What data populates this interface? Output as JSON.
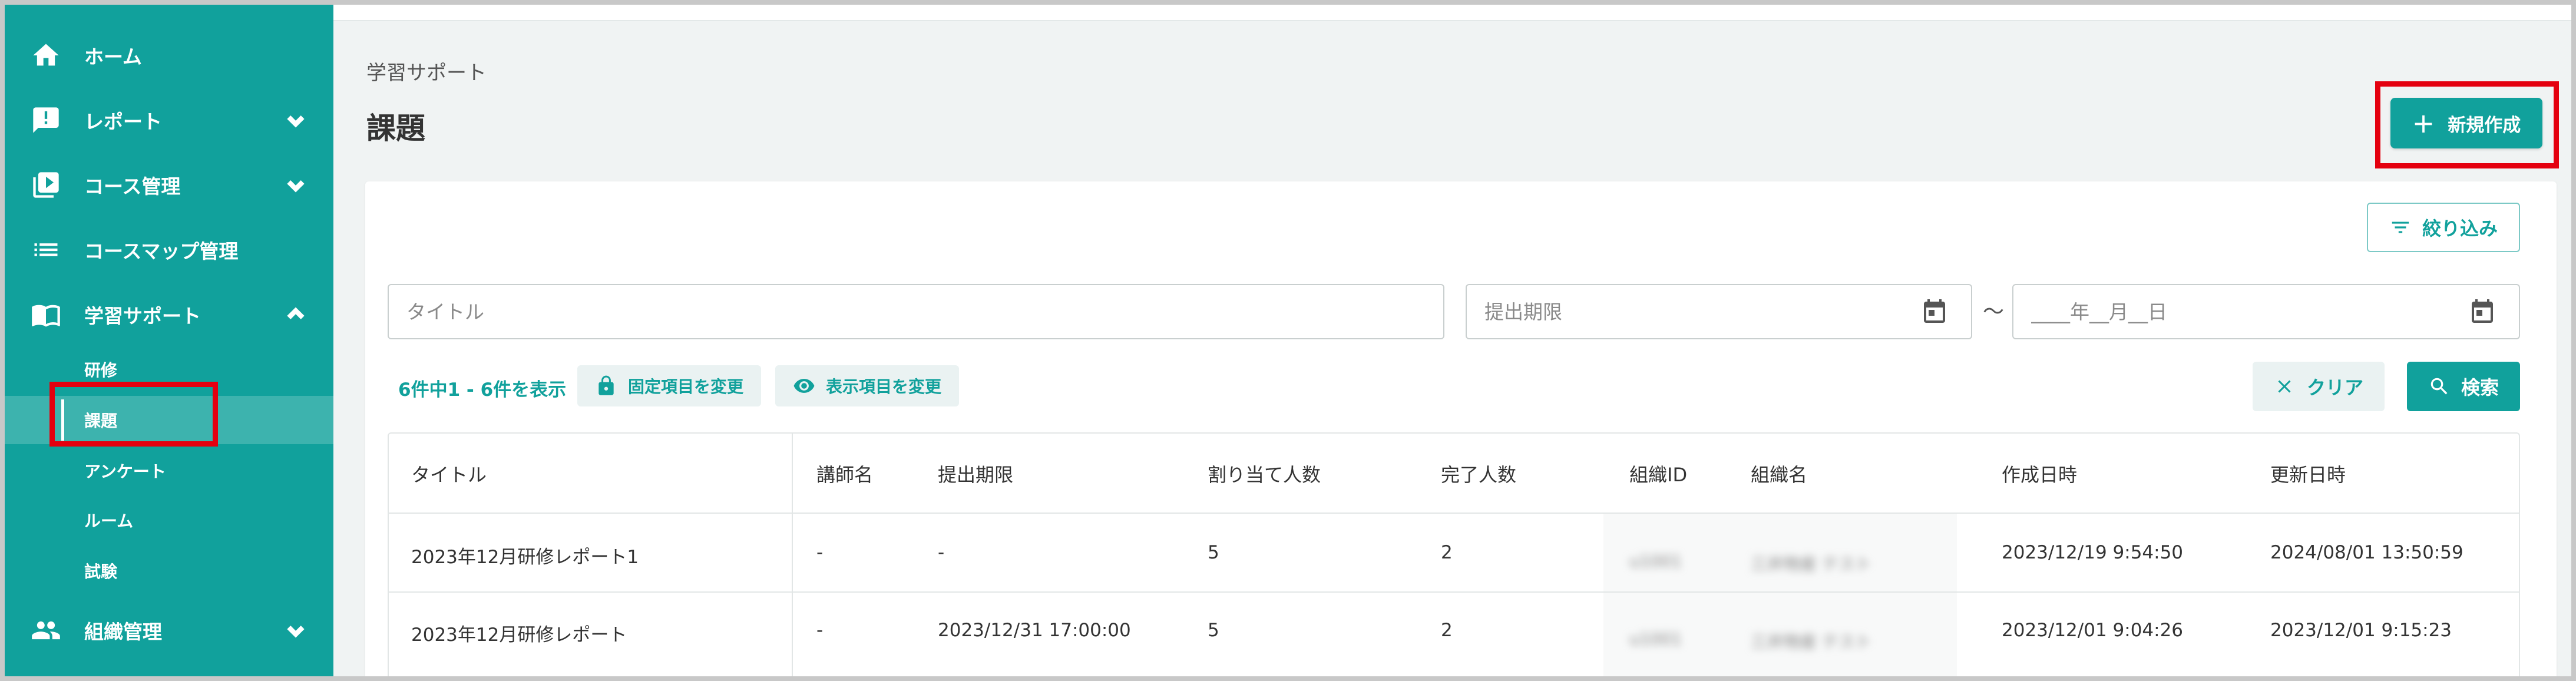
{
  "sidebar": {
    "items": [
      {
        "label": "ホーム"
      },
      {
        "label": "レポート"
      },
      {
        "label": "コース管理"
      },
      {
        "label": "コースマップ管理"
      },
      {
        "label": "学習サポート"
      },
      {
        "label": "組織管理"
      }
    ],
    "sub_items": [
      {
        "label": "研修"
      },
      {
        "label": "課題"
      },
      {
        "label": "アンケート"
      },
      {
        "label": "ルーム"
      },
      {
        "label": "試験"
      }
    ]
  },
  "header": {
    "breadcrumb": "学習サポート",
    "title": "課題",
    "new_button": "新規作成"
  },
  "filters": {
    "filter_button": "絞り込み",
    "title_placeholder": "タイトル",
    "deadline_placeholder": "提出期限",
    "tilde": "～",
    "date_placeholder": "____年__月__日"
  },
  "results": {
    "count": "6件中1 - 6件を表示",
    "fixed_columns_button": "固定項目を変更",
    "display_columns_button": "表示項目を変更",
    "clear_button": "クリア",
    "search_button": "検索"
  },
  "table": {
    "headers": [
      "タイトル",
      "講師名",
      "提出期限",
      "割り当て人数",
      "完了人数",
      "組織ID",
      "組織名",
      "作成日時",
      "更新日時"
    ],
    "rows": [
      [
        "2023年12月研修レポート1",
        "-",
        "-",
        "5",
        "2",
        "u1001",
        "三井物産 テスト",
        "2023/12/19 9:54:50",
        "2024/08/01 13:50:59"
      ],
      [
        "2023年12月研修レポート",
        "-",
        "2023/12/31 17:00:00",
        "5",
        "2",
        "u1001",
        "三井物産 テスト",
        "2023/12/01 9:04:26",
        "2023/12/01 9:15:23"
      ]
    ]
  },
  "colors": {
    "brand": "#11a19c",
    "highlight": "#e4000f"
  }
}
